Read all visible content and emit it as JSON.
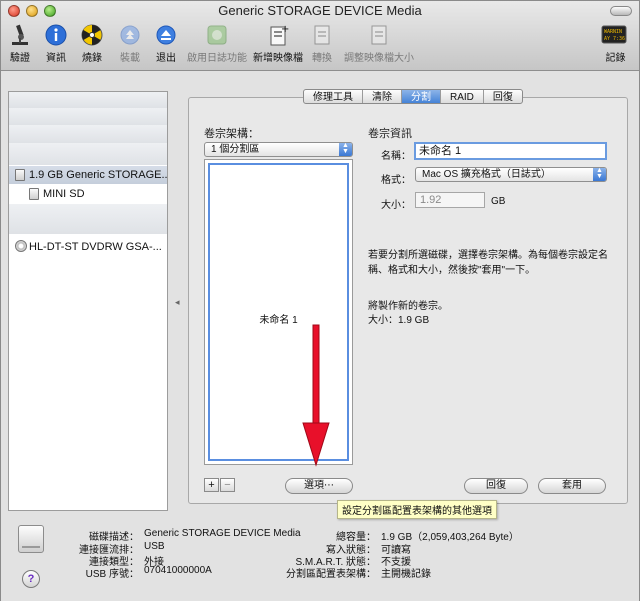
{
  "window": {
    "title": "Generic STORAGE DEVICE Media"
  },
  "toolbar": {
    "items": [
      {
        "label": "驗證",
        "icon": "microscope-icon"
      },
      {
        "label": "資訊",
        "icon": "info-icon"
      },
      {
        "label": "燒錄",
        "icon": "burn-icon"
      },
      {
        "label": "裝載",
        "icon": "mount-icon"
      },
      {
        "label": "退出",
        "icon": "eject-icon"
      },
      {
        "label": "啟用日誌功能",
        "icon": "journal-icon"
      },
      {
        "label": "新增映像檔",
        "icon": "new-image-icon"
      },
      {
        "label": "轉換",
        "icon": "convert-icon"
      },
      {
        "label": "調整映像檔大小",
        "icon": "resize-image-icon"
      },
      {
        "label": "記錄",
        "icon": "log-icon"
      }
    ],
    "log_screen_text": "WARNIN\nAY 7:36"
  },
  "sidebar": {
    "items": [
      {
        "label": "1.9 GB Generic STORAGE..."
      },
      {
        "label": "MINI SD"
      },
      {
        "label": "HL-DT-ST DVDRW GSA-..."
      }
    ]
  },
  "tabs": [
    "修理工具",
    "清除",
    "分割",
    "RAID",
    "回復"
  ],
  "partition": {
    "layout_title": "卷宗架構：",
    "layout_value": "1 個分割區",
    "info_title": "卷宗資訊",
    "name_label": "名稱：",
    "name_value": "未命名 1",
    "format_label": "格式：",
    "format_value": "Mac OS 擴充格式（日誌式）",
    "size_label": "大小：",
    "size_value": "1.92",
    "size_unit": "GB",
    "instructions": "若要分割所選磁碟，選擇卷宗架構。為每個卷宗設定名稱、格式和大小，然後按\"套用\"一下。",
    "summary_line1": "將製作新的卷宗。",
    "summary_line2": "大小：1.9 GB",
    "partition_label": "未命名 1",
    "add_label": "+",
    "remove_label": "−",
    "options_label": "選項⋯",
    "revert_label": "回復",
    "apply_label": "套用",
    "tooltip": "設定分割區配置表架構的其他選項"
  },
  "info": {
    "left": [
      {
        "label": "磁碟描述：",
        "value": "Generic STORAGE DEVICE Media"
      },
      {
        "label": "連接匯流排：",
        "value": "USB"
      },
      {
        "label": "連接類型：",
        "value": "外接"
      },
      {
        "label": "USB 序號：",
        "value": "07041000000A"
      }
    ],
    "right": [
      {
        "label": "總容量：",
        "value": "1.9 GB（2,059,403,264 Byte）"
      },
      {
        "label": "寫入狀態：",
        "value": "可讀寫"
      },
      {
        "label": "S.M.A.R.T. 狀態：",
        "value": "不支援"
      },
      {
        "label": "分割區配置表架構：",
        "value": "主開機記錄"
      }
    ],
    "help_label": "?"
  },
  "colors": {
    "accent": "#3f7fd6",
    "arrow": "#e8102a"
  }
}
